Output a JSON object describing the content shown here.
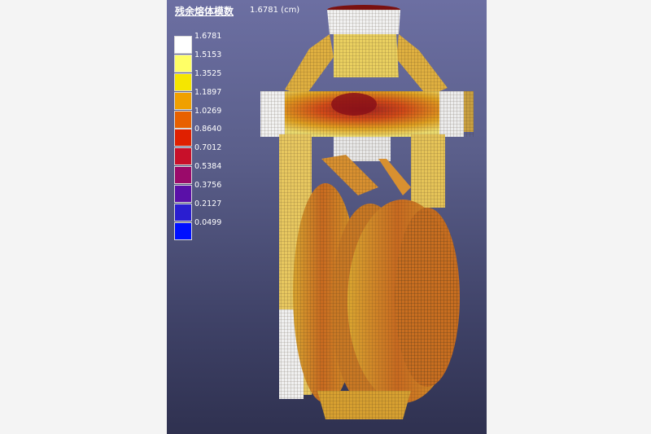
{
  "view": {
    "title": "残余熔体模数",
    "max_readout": "1.6781 (cm)",
    "background_top": "#6c6fa2",
    "background_bottom": "#2f3150"
  },
  "legend": {
    "entries": [
      {
        "label": "1.6781",
        "color": "#ffffff"
      },
      {
        "label": "1.5153",
        "color": "#ffff66"
      },
      {
        "label": "1.3525",
        "color": "#f5e600"
      },
      {
        "label": "1.1897",
        "color": "#f0a000"
      },
      {
        "label": "1.0269",
        "color": "#e86000"
      },
      {
        "label": "0.8640",
        "color": "#e02000"
      },
      {
        "label": "0.7012",
        "color": "#c8102a"
      },
      {
        "label": "0.5384",
        "color": "#9a0a6a"
      },
      {
        "label": "0.3756",
        "color": "#5a10a8"
      },
      {
        "label": "0.2127",
        "color": "#2a1ed0"
      },
      {
        "label": "0.0499",
        "color": "#0010ff"
      }
    ]
  },
  "render": {
    "mesh_line_color": "#3a2a1a",
    "casting_colors": [
      "#ffffff",
      "#e8e060",
      "#d9a020",
      "#d07020",
      "#c84818",
      "#b02818"
    ]
  }
}
